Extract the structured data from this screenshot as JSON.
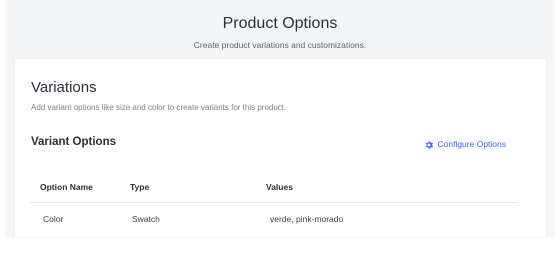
{
  "header": {
    "title": "Product Options",
    "subtitle": "Create product variations and customizations."
  },
  "variations": {
    "title": "Variations",
    "description": "Add variant options like size and color to create variants for this product."
  },
  "variant_options": {
    "title": "Variant Options",
    "configure_label": "Configure Options",
    "configure_icon": "gear-icon",
    "accent_color": "#3c64f4",
    "columns": [
      "Option Name",
      "Type",
      "Values"
    ],
    "rows": [
      {
        "name": "Color",
        "type": "Swatch",
        "values": "verde, pink-morado"
      }
    ]
  }
}
